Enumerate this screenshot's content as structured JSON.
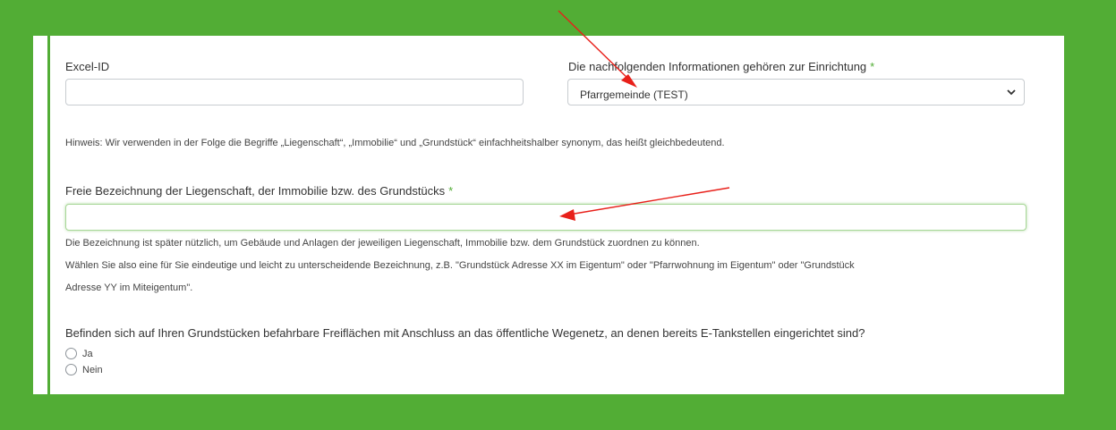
{
  "form": {
    "excel_id": {
      "label": "Excel-ID",
      "value": ""
    },
    "facility": {
      "label": "Die nachfolgenden Informationen gehören zur Einrichtung",
      "required_mark": "*",
      "selected": "Pfarrgemeinde (TEST)"
    },
    "note": "Hinweis: Wir verwenden in der Folge die Begriffe „Liegenschaft“, „Immobilie“ und „Grundstück“ einfachheitshalber synonym, das heißt gleichbedeutend.",
    "property_name": {
      "label": "Freie Bezeichnung der Liegenschaft, der Immobilie bzw. des Grundstücks",
      "required_mark": "*",
      "value": "",
      "help_line1": "Die Bezeichnung ist später nützlich, um Gebäude und Anlagen der jeweiligen Liegenschaft, Immobilie bzw. dem Grundstück zuordnen zu können.",
      "help_line2": "Wählen Sie also eine für Sie eindeutige und leicht zu unterscheidende Bezeichnung, z.B. \"Grundstück Adresse XX im Eigentum\" oder \"Pfarrwohnung im Eigentum\" oder \"Grundstück",
      "help_line3": "Adresse YY im Miteigentum\"."
    },
    "charging_question": {
      "label": "Befinden sich auf Ihren Grundstücken befahrbare Freiflächen mit Anschluss an das öffentliche Wegenetz, an denen bereits E-Tankstellen eingerichtet sind?",
      "options": [
        "Ja",
        "Nein"
      ]
    }
  },
  "colors": {
    "background": "#52ad35",
    "accent": "#52ad35",
    "annotation_arrow": "#e8201a"
  },
  "icons": {
    "select_chevron": "chevron-down-icon",
    "annotation": "arrow-annotation"
  }
}
